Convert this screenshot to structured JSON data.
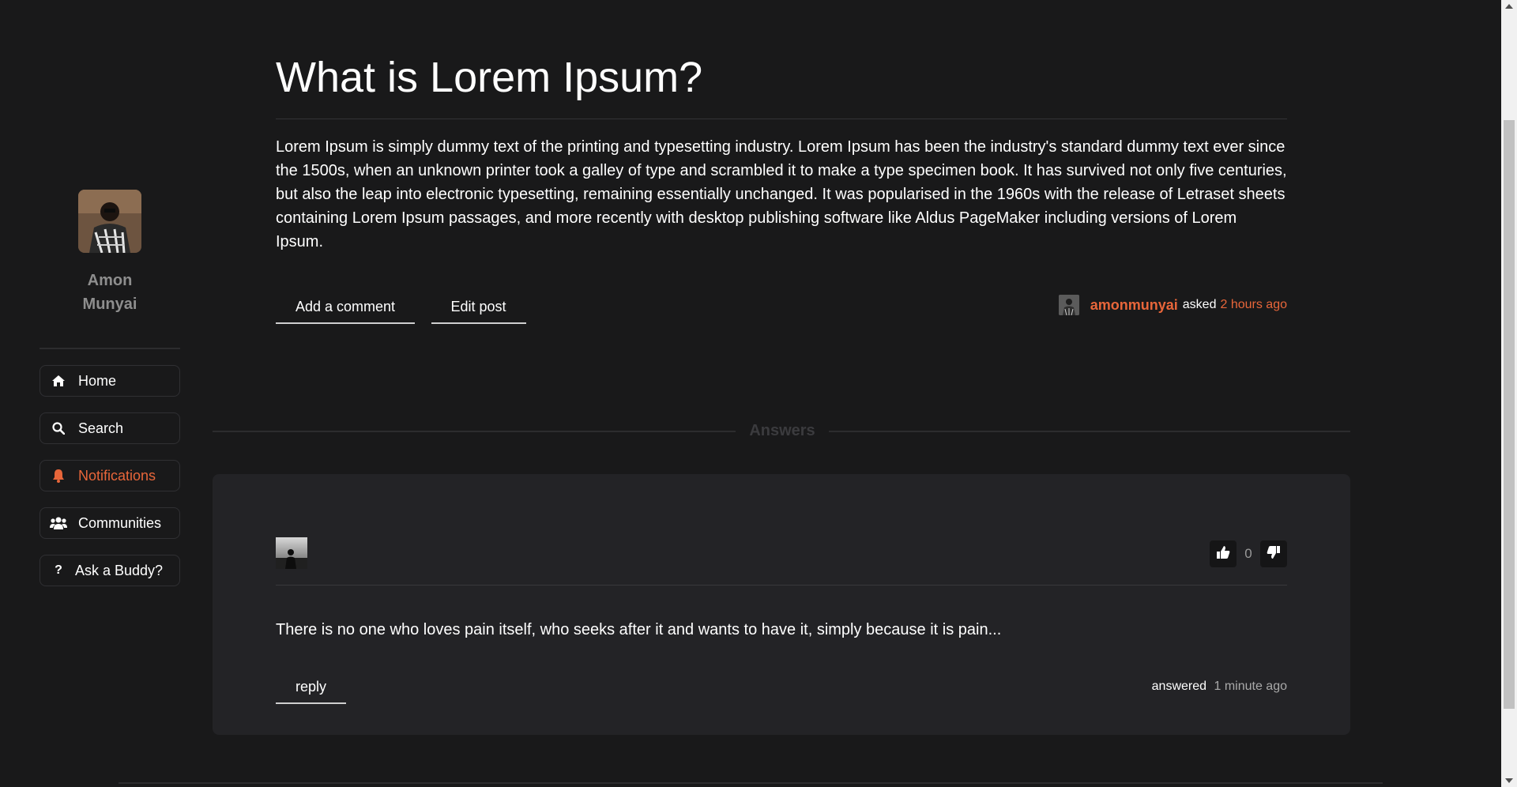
{
  "user": {
    "name": "Amon Munyai"
  },
  "nav": {
    "items": [
      {
        "label": "Home",
        "icon": "home-icon"
      },
      {
        "label": "Search",
        "icon": "search-icon"
      },
      {
        "label": "Notifications",
        "icon": "bell-icon",
        "active": true
      },
      {
        "label": "Communities",
        "icon": "users-icon"
      },
      {
        "label": "Ask a Buddy?",
        "icon": "question-icon"
      }
    ]
  },
  "post": {
    "title": "What is Lorem Ipsum?",
    "body": "Lorem Ipsum is simply dummy text of the printing and typesetting industry. Lorem Ipsum has been the industry's standard dummy text ever since the 1500s, when an unknown printer took a galley of type and scrambled it to make a type specimen book. It has survived not only five centuries, but also the leap into electronic typesetting, remaining essentially unchanged. It was popularised in the 1960s with the release of Letraset sheets containing Lorem Ipsum passages, and more recently with desktop publishing software like Aldus PageMaker including versions of Lorem Ipsum.",
    "add_comment_label": "Add a comment",
    "edit_post_label": "Edit post",
    "author": "amonmunyai",
    "asked_label": "asked",
    "asked_time": "2 hours ago"
  },
  "answers": {
    "section_label": "Answers",
    "items": [
      {
        "votes": "0",
        "body": "There is no one who loves pain itself, who seeks after it and wants to have it, simply because it is pain...",
        "reply_label": "reply",
        "answered_label": "answered",
        "answered_time": "1 minute ago"
      }
    ]
  },
  "colors": {
    "background": "#19191a",
    "card": "#232326",
    "accent": "#e8663a"
  }
}
